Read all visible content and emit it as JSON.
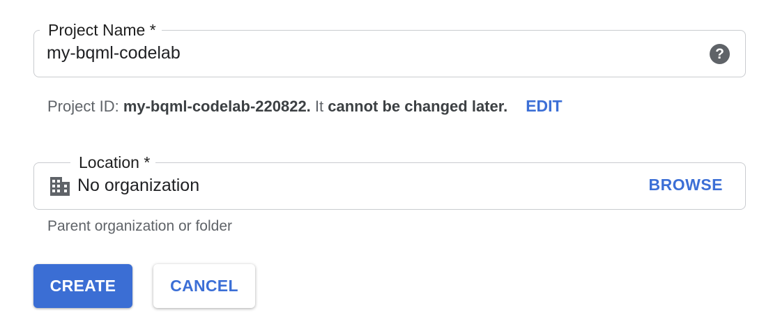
{
  "project_name": {
    "label": "Project Name  *",
    "value": "my-bqml-codelab",
    "help_icon": "help-circle-icon",
    "help_symbol": "?"
  },
  "project_id": {
    "prefix": "Project ID: ",
    "id": "my-bqml-codelab-220822.",
    "middle": " It ",
    "warning": "cannot be changed later.",
    "edit_label": "EDIT"
  },
  "location": {
    "label": "Location *",
    "value": "No organization",
    "icon": "building-icon",
    "browse_label": "BROWSE",
    "hint": "Parent organization or folder"
  },
  "actions": {
    "create_label": "CREATE",
    "cancel_label": "CANCEL"
  },
  "colors": {
    "accent": "#3b6ed4",
    "link": "#3c6fd6",
    "border": "#c9cbcf",
    "secondary_text": "#5f6368"
  }
}
